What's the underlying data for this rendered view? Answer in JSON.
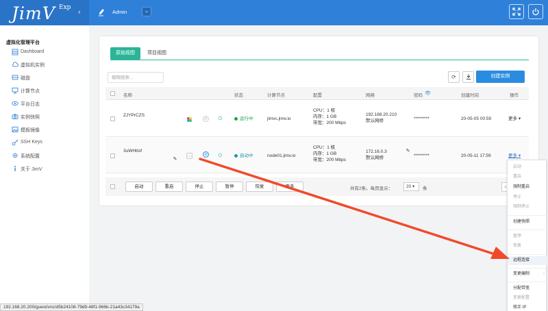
{
  "topbar": {
    "logo": "JimV",
    "logo_sup": "Exp",
    "user": "Admin",
    "fullscreen_icon": "expand-icon",
    "power_icon": "power-icon"
  },
  "sidebar": {
    "title": "虚拟化管理平台",
    "items": [
      {
        "label": "Dashboard",
        "icon": "dashboard-icon"
      },
      {
        "label": "虚拟机实例",
        "icon": "cloud-icon"
      },
      {
        "label": "磁盘",
        "icon": "disk-icon"
      },
      {
        "label": "计算节点",
        "icon": "monitor-icon"
      },
      {
        "label": "平台日志",
        "icon": "eye-icon"
      },
      {
        "label": "实例快照",
        "icon": "camera-icon"
      },
      {
        "label": "模板镜像",
        "icon": "image-icon"
      },
      {
        "label": "SSH Keys",
        "icon": "key-icon"
      },
      {
        "label": "系统配置",
        "icon": "gear-icon"
      },
      {
        "label": "关于 JimV",
        "icon": "info-icon"
      }
    ]
  },
  "main": {
    "tabs": [
      {
        "label": "原始视图"
      },
      {
        "label": "项目视图"
      }
    ],
    "search_placeholder": "模糊搜索...",
    "create_label": "创建实例",
    "columns": {
      "name": "名称",
      "status": "状态",
      "node": "计算节点",
      "config": "配置",
      "network": "网络",
      "password": "密码",
      "created": "创建时间",
      "actions": "操作"
    },
    "rows": [
      {
        "name": "ZJYPrCZS",
        "status": "运行中",
        "node": "jimvc.jimv.io",
        "cpu": "CPU：1 核",
        "mem": "内存：1 GB",
        "bw": "带宽：200 Mbps",
        "ip": "192.168.20.210",
        "net": "默认网桥",
        "password": "*********",
        "created": "20-05-05 00:59",
        "more": "更多"
      },
      {
        "name": "3uWHtIof",
        "status": "启动中",
        "node": "node01.jimv.io",
        "cpu": "CPU：1 核",
        "mem": "内存：1 GB",
        "bw": "带宽：200 Mbps",
        "ip": "172.16.0.3",
        "net": "默认网桥",
        "password": "*********",
        "created": "20-05-11 17:59",
        "more": "更多"
      }
    ],
    "footer_buttons": [
      "启动",
      "重启",
      "停止",
      "暂停",
      "恢复",
      "更多"
    ],
    "pager_text": "共有2条。每页显示：",
    "page_size": "20",
    "page_unit": "条"
  },
  "menu": {
    "items": [
      {
        "label": "启动",
        "disabled": true
      },
      {
        "label": "重启",
        "disabled": true
      },
      {
        "label": "强制重启",
        "disabled": false
      },
      {
        "label": "停止",
        "disabled": true
      },
      {
        "label": "强制停止",
        "disabled": true
      },
      {
        "label": "创建快照",
        "disabled": false
      },
      {
        "label": "暂停",
        "disabled": true
      },
      {
        "label": "恢复",
        "disabled": true
      },
      {
        "label": "远程连接",
        "disabled": false
      },
      {
        "label": "变更编制",
        "disabled": false
      },
      {
        "label": "分配带宽",
        "disabled": false
      },
      {
        "label": "变更配置",
        "disabled": true
      },
      {
        "label": "修正 IP",
        "disabled": false
      }
    ]
  },
  "statusbar": {
    "url": "192.168.20.200/guest/vnc/d5b24108-79d9-48f1-966b-21a43c34179a"
  },
  "colors": {
    "topbar": "#2f80d9",
    "accent_green": "#2ab597",
    "primary_blue": "#2a8ce0",
    "arrow_red": "#f04a2a"
  }
}
